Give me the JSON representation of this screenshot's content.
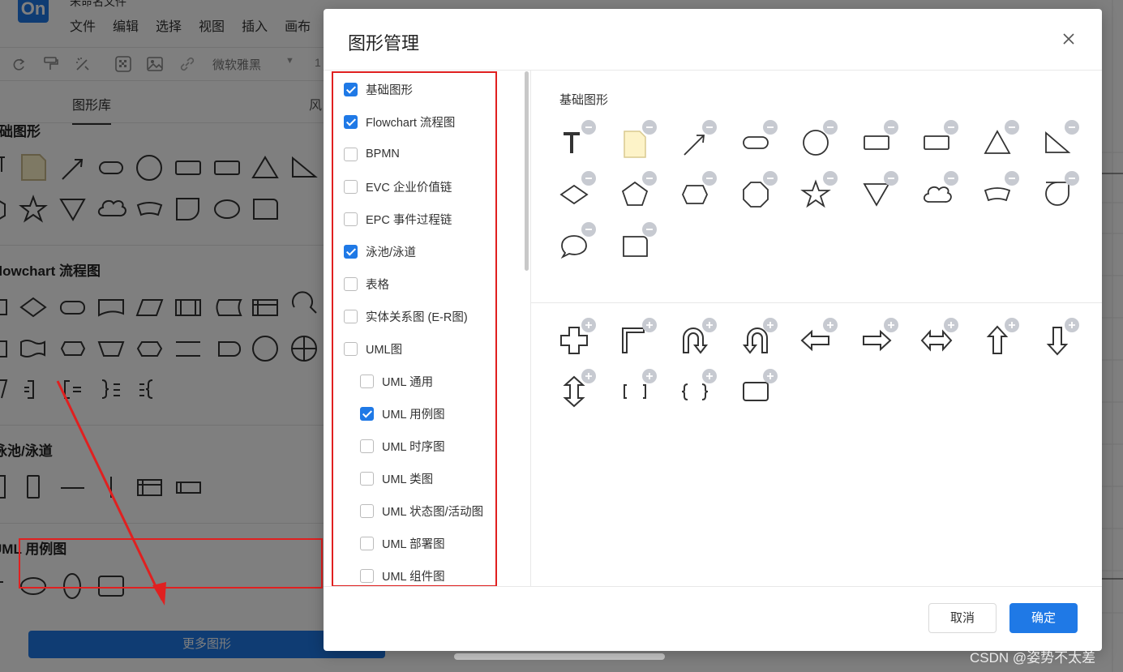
{
  "app": {
    "logo": "On",
    "title_fragment": "未命名文件",
    "menu": [
      "文件",
      "编辑",
      "选择",
      "视图",
      "插入",
      "画布"
    ],
    "font_select": "微软雅黑",
    "font_size_fragment": "1"
  },
  "left_panel": {
    "tabs": [
      "图形库",
      "风"
    ],
    "sections": [
      "基础图形",
      "Flowchart 流程图",
      "泳池/泳道",
      "UML 用例图"
    ],
    "more_button": "更多图形"
  },
  "dialog": {
    "title": "图形管理",
    "categories": [
      {
        "label": "基础图形",
        "checked": true,
        "indent": false
      },
      {
        "label": "Flowchart 流程图",
        "checked": true,
        "indent": false
      },
      {
        "label": "BPMN",
        "checked": false,
        "indent": false
      },
      {
        "label": "EVC 企业价值链",
        "checked": false,
        "indent": false
      },
      {
        "label": "EPC 事件过程链",
        "checked": false,
        "indent": false
      },
      {
        "label": "泳池/泳道",
        "checked": true,
        "indent": false
      },
      {
        "label": "表格",
        "checked": false,
        "indent": false
      },
      {
        "label": "实体关系图 (E-R图)",
        "checked": false,
        "indent": false
      },
      {
        "label": "UML图",
        "checked": false,
        "indent": false
      },
      {
        "label": "UML 通用",
        "checked": false,
        "indent": true
      },
      {
        "label": "UML 用例图",
        "checked": true,
        "indent": true
      },
      {
        "label": "UML 时序图",
        "checked": false,
        "indent": true
      },
      {
        "label": "UML 类图",
        "checked": false,
        "indent": true
      },
      {
        "label": "UML 状态图/活动图",
        "checked": false,
        "indent": true
      },
      {
        "label": "UML 部署图",
        "checked": false,
        "indent": true
      },
      {
        "label": "UML 组件图",
        "checked": false,
        "indent": true
      }
    ],
    "selected_section_title": "基础图形",
    "selected_shapes": [
      "text",
      "note",
      "arrow-line",
      "rounded-rect",
      "circle",
      "rectangle",
      "rectangle",
      "triangle",
      "right-triangle",
      "diamond",
      "pentagon",
      "hexagon",
      "octagon",
      "star",
      "inverted-triangle",
      "cloud",
      "arc-band",
      "round-corner-square",
      "speech-bubble",
      "rounded-corner-square"
    ],
    "available_shapes": [
      "cross",
      "corner",
      "u-turn-right",
      "u-turn-left",
      "arrow-left",
      "arrow-right",
      "arrow-both",
      "arrow-up",
      "arrow-down",
      "arrow-up-down",
      "bracket",
      "brace",
      "callout-rect"
    ],
    "cancel_label": "取消",
    "confirm_label": "确定"
  },
  "colors": {
    "accent": "#1f79e6",
    "highlight": "#e02020",
    "note_fill": "#fdf3c8",
    "badge": "#c7cad1"
  },
  "watermark": "CSDN @姿势不太差"
}
